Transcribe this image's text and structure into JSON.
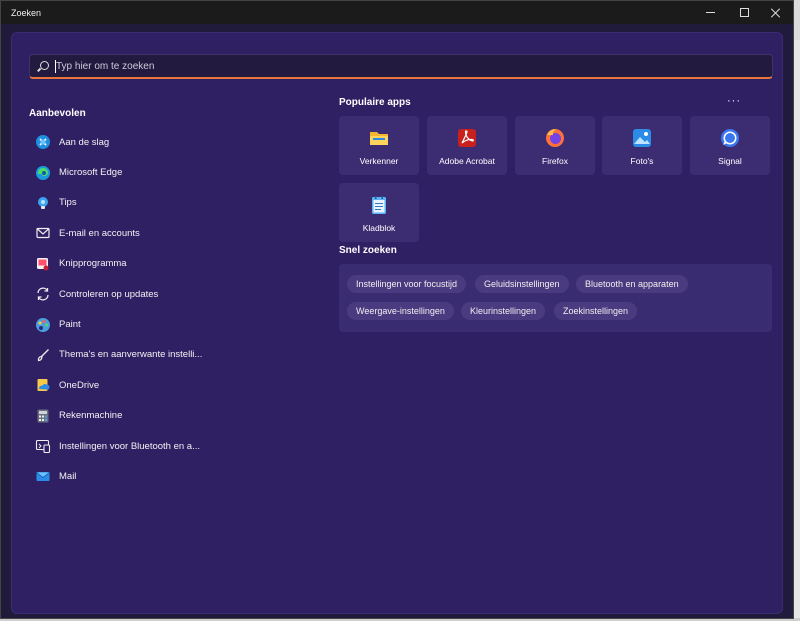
{
  "window": {
    "title": "Zoeken"
  },
  "search": {
    "placeholder": "Typ hier om te zoeken",
    "value": ""
  },
  "recommended": {
    "title": "Aanbevolen",
    "items": [
      {
        "label": "Aan de slag",
        "icon": "get-started-icon"
      },
      {
        "label": "Microsoft Edge",
        "icon": "edge-icon"
      },
      {
        "label": "Tips",
        "icon": "tips-icon"
      },
      {
        "label": "E-mail en accounts",
        "icon": "mail-accounts-icon"
      },
      {
        "label": "Knipprogramma",
        "icon": "snipping-tool-icon"
      },
      {
        "label": "Controleren op updates",
        "icon": "update-icon"
      },
      {
        "label": "Paint",
        "icon": "paint-icon"
      },
      {
        "label": "Thema's en aanverwante instelli...",
        "icon": "brush-icon"
      },
      {
        "label": "OneDrive",
        "icon": "onedrive-icon"
      },
      {
        "label": "Rekenmachine",
        "icon": "calculator-icon"
      },
      {
        "label": "Instellingen voor Bluetooth en a...",
        "icon": "bluetooth-settings-icon"
      },
      {
        "label": "Mail",
        "icon": "mail-icon"
      }
    ]
  },
  "popular": {
    "title": "Populaire apps",
    "more": "···",
    "apps": [
      {
        "label": "Verkenner",
        "icon": "folder-icon"
      },
      {
        "label": "Adobe Acrobat",
        "icon": "acrobat-icon"
      },
      {
        "label": "Firefox",
        "icon": "firefox-icon"
      },
      {
        "label": "Foto's",
        "icon": "photos-icon"
      },
      {
        "label": "Signal",
        "icon": "signal-icon"
      },
      {
        "label": "Kladblok",
        "icon": "notepad-icon"
      }
    ]
  },
  "quick_search": {
    "title": "Snel zoeken",
    "chips": [
      "Instellingen voor focustijd",
      "Geluidsinstellingen",
      "Bluetooth en apparaten",
      "Weergave-instellingen",
      "Kleurinstellingen",
      "Zoekinstellingen"
    ]
  }
}
